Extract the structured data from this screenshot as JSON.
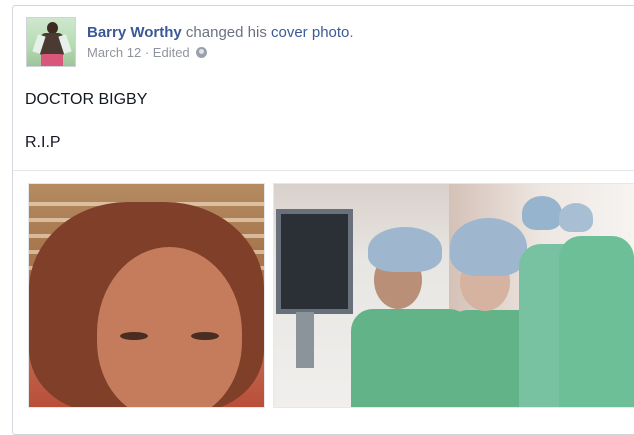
{
  "post": {
    "author": "Barry Worthy",
    "action_prefix": "changed his",
    "action_link": "cover photo",
    "action_suffix": ".",
    "date": "March 12",
    "separator": "·",
    "edited": "Edited",
    "privacy_icon": "globe-icon",
    "message_lines": [
      "DOCTOR BIGBY",
      "R.I.P"
    ],
    "photos": [
      {
        "name": "left-photo",
        "description": "portrait of a woman with reddish hair"
      },
      {
        "name": "right-photo",
        "description": "two people in surgical scrubs and caps"
      }
    ]
  },
  "colors": {
    "link": "#3b5998",
    "meta": "#90949c",
    "text": "#141823"
  }
}
